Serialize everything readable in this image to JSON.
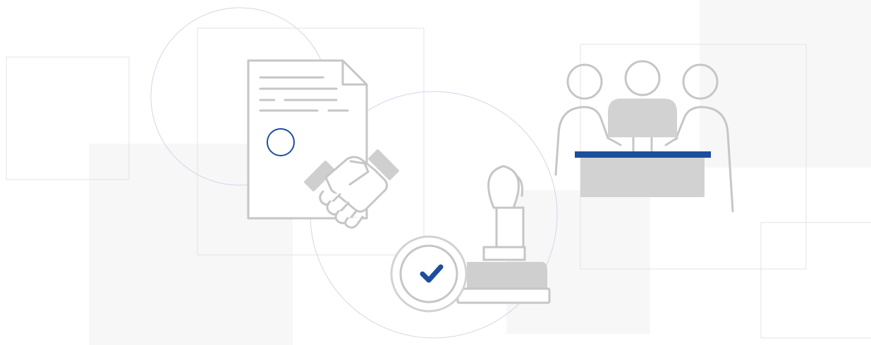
{
  "illustration": {
    "icons": [
      "document-icon",
      "handshake-icon",
      "stamp-icon",
      "checkmark-icon",
      "meeting-icon"
    ],
    "colors": {
      "background": "#ffffff",
      "panel_fill": "#f7f7f7",
      "frame_stroke": "#e3e3e8",
      "circle_stroke": "#c9c9e6",
      "icon_gray": "#c6c6c6",
      "icon_fill": "#d2d2d2",
      "accent_blue": "#1d4e9c"
    }
  }
}
